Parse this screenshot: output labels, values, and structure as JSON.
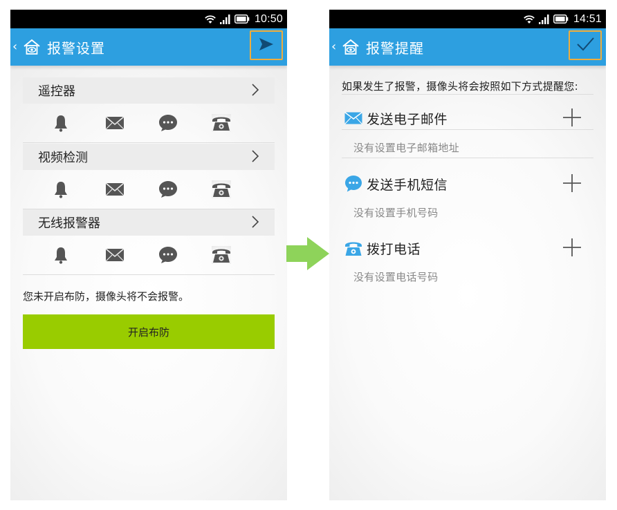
{
  "left_screen": {
    "status": {
      "time": "10:50"
    },
    "title": "报警设置",
    "sections": [
      {
        "label": "遥控器",
        "icons": [
          "bell-icon",
          "mail-icon",
          "chat-icon",
          "telephone-icon"
        ]
      },
      {
        "label": "视频检测",
        "icons": [
          "bell-icon",
          "mail-icon",
          "chat-icon",
          "telephone-icon"
        ]
      },
      {
        "label": "无线报警器",
        "icons": [
          "bell-icon",
          "mail-icon",
          "chat-icon",
          "telephone-icon"
        ]
      }
    ],
    "info_text": "您未开启布防，摄像头将不会报警。",
    "arm_button_label": "开启布防",
    "action_icon": "send-icon"
  },
  "right_screen": {
    "status": {
      "time": "14:51"
    },
    "title": "报警提醒",
    "intro": "如果发生了报警，摄像头将会按照如下方式提醒您:",
    "methods": [
      {
        "icon": "email-icon",
        "label": "发送电子邮件",
        "detail": "没有设置电子邮箱地址"
      },
      {
        "icon": "sms-icon",
        "label": "发送手机短信",
        "detail": "没有设置手机号码"
      },
      {
        "icon": "telephone-icon",
        "label": "拨打电话",
        "detail": "没有设置电话号码"
      }
    ],
    "action_icon": "check-icon"
  },
  "colors": {
    "title_bar": "#2d9fe0",
    "action_highlight": "#f0ad3c",
    "arm_button": "#99cc00",
    "flow_arrow": "#8ed35a",
    "method_icon": "#3aa6e6"
  }
}
